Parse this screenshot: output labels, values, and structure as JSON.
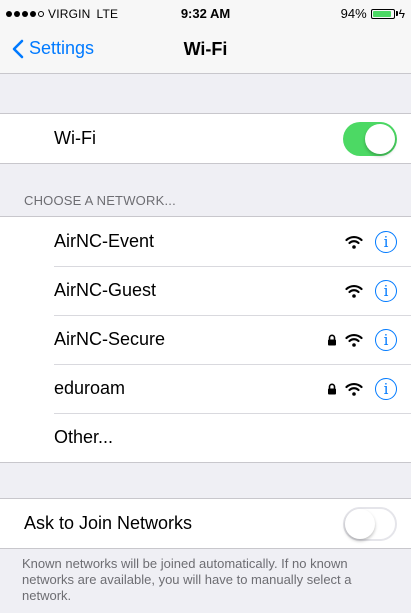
{
  "status_bar": {
    "carrier": "VIRGIN",
    "network": "LTE",
    "time": "9:32 AM",
    "battery": "94%",
    "battery_level": 0.94,
    "signal_bars": 4
  },
  "nav": {
    "back_label": "Settings",
    "title": "Wi-Fi"
  },
  "wifi": {
    "label": "Wi-Fi",
    "enabled": true
  },
  "networks_header": "CHOOSE A NETWORK...",
  "networks": [
    {
      "name": "AirNC-Event",
      "secured": false
    },
    {
      "name": "AirNC-Guest",
      "secured": false
    },
    {
      "name": "AirNC-Secure",
      "secured": true
    },
    {
      "name": "eduroam",
      "secured": true
    }
  ],
  "other_label": "Other...",
  "ask_to_join": {
    "label": "Ask to Join Networks",
    "enabled": false
  },
  "footer_text": "Known networks will be joined automatically. If no known networks are available, you will have to manually select a network.",
  "info_glyph": "i",
  "colors": {
    "accent": "#007aff",
    "toggle_on": "#4cd964",
    "background": "#efeff4"
  }
}
